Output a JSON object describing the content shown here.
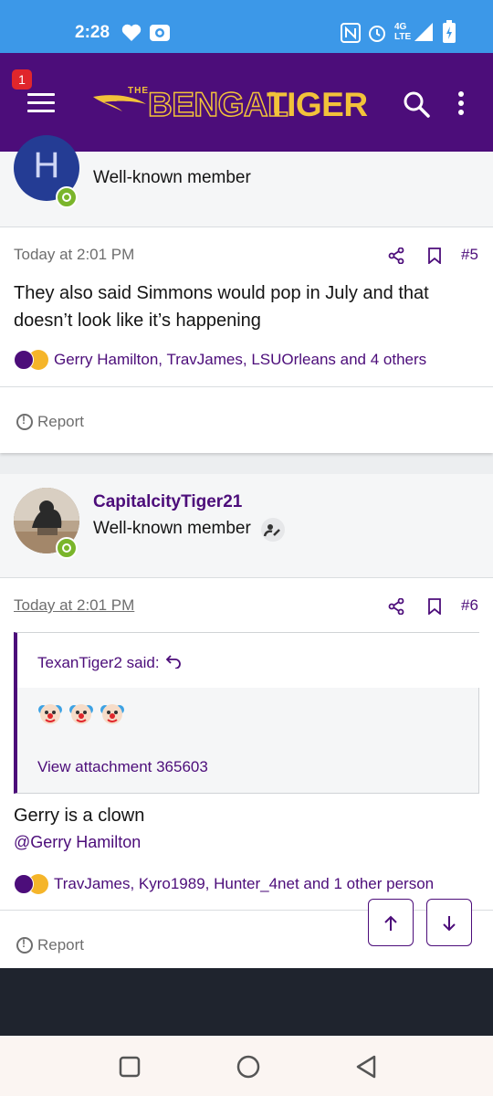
{
  "status_bar": {
    "time": "2:28",
    "network": "4G LTE",
    "icons": [
      "heart-icon",
      "camera-icon",
      "nfc-icon",
      "alarm-icon",
      "signal-icon",
      "battery-icon"
    ]
  },
  "header": {
    "notification_count": "1",
    "logo_the": "THE",
    "logo_bengal": "BENGAL",
    "logo_tiger": "TIGER",
    "brand_color": "#4c0d7a",
    "accent_color": "#f2c23a"
  },
  "post5": {
    "user": {
      "avatar_letter": "H",
      "title": "Well-known member"
    },
    "date": "Today at 2:01 PM",
    "number": "#5",
    "body": "They also said Simmons would pop in July and that doesn’t look like it’s happening",
    "reactions_text": "Gerry Hamilton, TravJames, LSUOrleans and 4 others",
    "report_label": "Report"
  },
  "post6": {
    "user": {
      "name": "CapitalcityTiger21",
      "title": "Well-known member"
    },
    "date": "Today at 2:01 PM",
    "number": "#6",
    "quote": {
      "author": "TexanTiger2 said:",
      "attachment_label": "View attachment 365603"
    },
    "body": "Gerry is a clown",
    "mention": "@Gerry Hamilton",
    "reactions_text": "TravJames, Kyro1989, Hunter_4net and 1 other person",
    "report_label": "Report"
  }
}
